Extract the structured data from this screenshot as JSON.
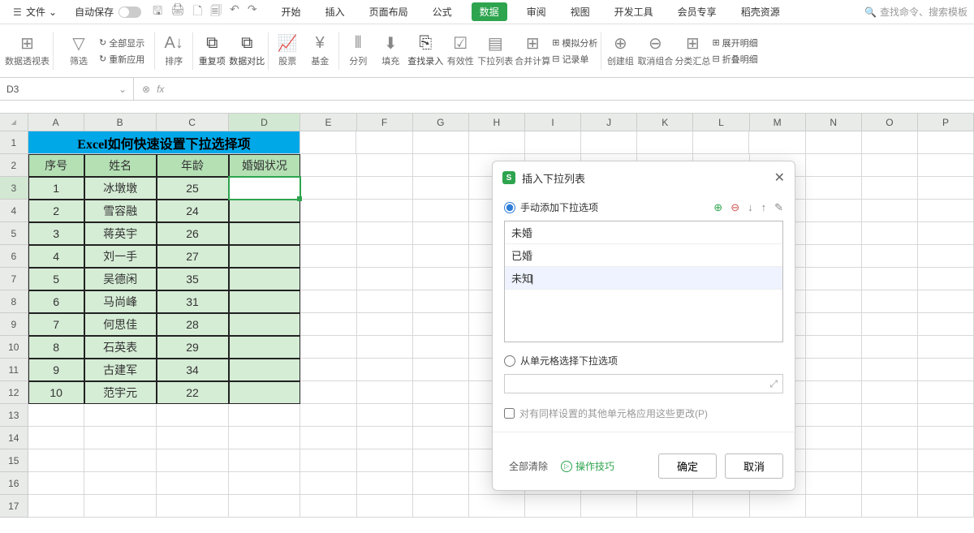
{
  "menubar": {
    "file": "文件",
    "autosave": "自动保存",
    "tabs": [
      "开始",
      "插入",
      "页面布局",
      "公式",
      "数据",
      "审阅",
      "视图",
      "开发工具",
      "会员专享",
      "稻壳资源"
    ],
    "active_tab_index": 4,
    "search_placeholder": "查找命令、搜索模板"
  },
  "ribbon": {
    "pivot": "数据透视表",
    "filter": "筛选",
    "show_all": "全部显示",
    "reapply": "重新应用",
    "sort": "排序",
    "dup": "重复项",
    "compare": "数据对比",
    "stock": "股票",
    "fund": "基金",
    "split": "分列",
    "fill": "填充",
    "findentry": "查找录入",
    "validity": "有效性",
    "droplist": "下拉列表",
    "consolidate": "合并计算",
    "record": "记录单",
    "simulate": "模拟分析",
    "group": "创建组",
    "ungroup": "取消组合",
    "subtotal": "分类汇总",
    "expand": "展开明细",
    "collapse": "折叠明细"
  },
  "namebox": "D3",
  "columns": [
    "A",
    "B",
    "C",
    "D",
    "E",
    "F",
    "G",
    "H",
    "I",
    "J",
    "K",
    "L",
    "M",
    "N",
    "O",
    "P"
  ],
  "title_cell": "Excel如何快速设置下拉选择项",
  "headers": [
    "序号",
    "姓名",
    "年龄",
    "婚姻状况"
  ],
  "data_rows": [
    [
      "1",
      "冰墩墩",
      "25",
      ""
    ],
    [
      "2",
      "雪容融",
      "24",
      ""
    ],
    [
      "3",
      "蒋英宇",
      "26",
      ""
    ],
    [
      "4",
      "刘一手",
      "27",
      ""
    ],
    [
      "5",
      "吴德闲",
      "35",
      ""
    ],
    [
      "6",
      "马尚峰",
      "31",
      ""
    ],
    [
      "7",
      "何思佳",
      "28",
      ""
    ],
    [
      "8",
      "石英表",
      "29",
      ""
    ],
    [
      "9",
      "古建军",
      "34",
      ""
    ],
    [
      "10",
      "范宇元",
      "22",
      ""
    ]
  ],
  "dialog": {
    "title": "插入下拉列表",
    "opt_manual": "手动添加下拉选项",
    "opt_range": "从单元格选择下拉选项",
    "items": [
      "未婚",
      "已婚",
      "未知"
    ],
    "apply_same": "对有同样设置的其他单元格应用这些更改(P)",
    "clear": "全部清除",
    "tips": "操作技巧",
    "ok": "确定",
    "cancel": "取消"
  }
}
